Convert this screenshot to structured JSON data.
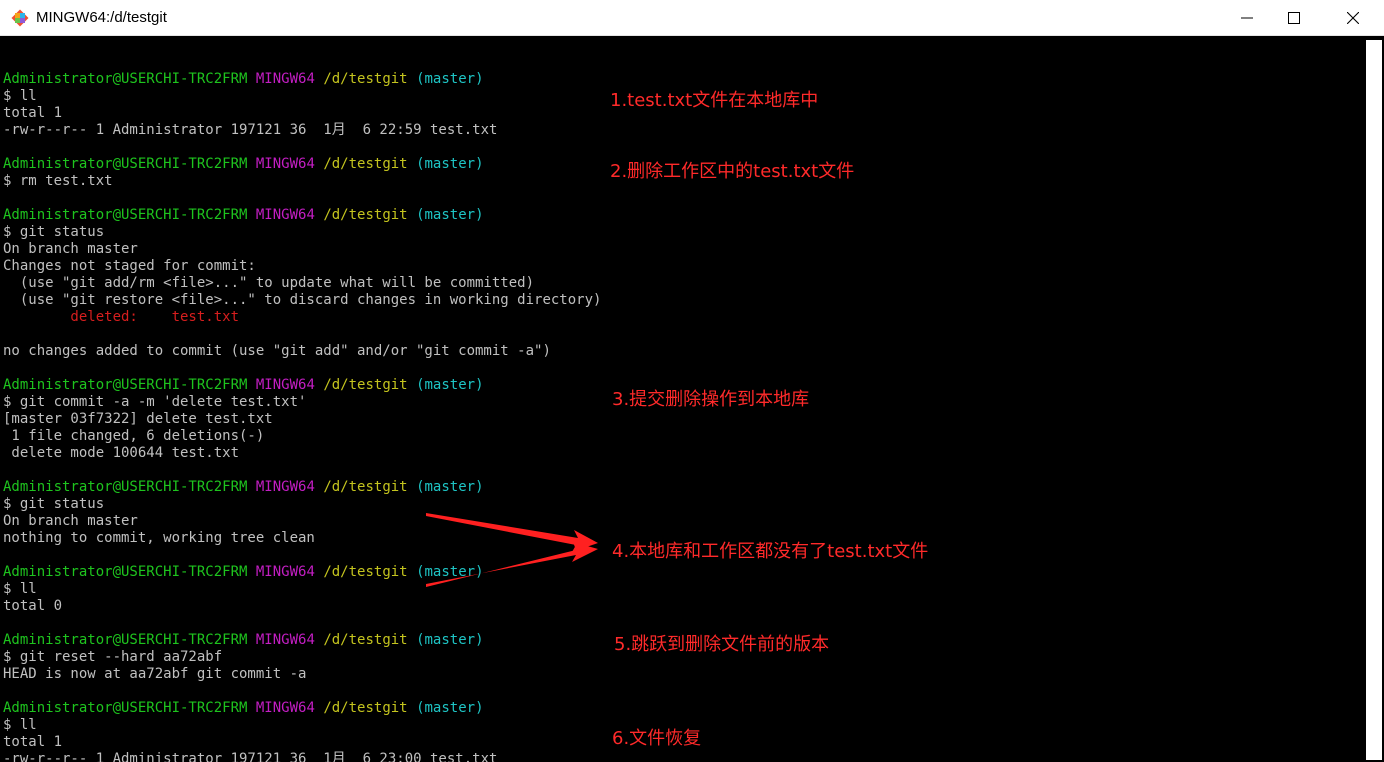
{
  "window": {
    "title": "MINGW64:/d/testgit",
    "app_icon": "git-diamond-icon",
    "controls": [
      "minimize-icon",
      "maximize-icon",
      "close-icon"
    ]
  },
  "prompt": {
    "user": "Administrator@USERCHI-TRC2FRM",
    "env": "MINGW64",
    "path": "/d/testgit",
    "branch": "(master)"
  },
  "terminal_lines": [
    {
      "type": "blank"
    },
    {
      "type": "prompt"
    },
    {
      "type": "text",
      "text": "$ ll"
    },
    {
      "type": "text",
      "text": "total 1"
    },
    {
      "type": "text",
      "text": "-rw-r--r-- 1 Administrator 197121 36  1月  6 22:59 test.txt"
    },
    {
      "type": "blank"
    },
    {
      "type": "prompt"
    },
    {
      "type": "text",
      "text": "$ rm test.txt"
    },
    {
      "type": "blank"
    },
    {
      "type": "prompt"
    },
    {
      "type": "text",
      "text": "$ git status"
    },
    {
      "type": "text",
      "text": "On branch master"
    },
    {
      "type": "text",
      "text": "Changes not staged for commit:"
    },
    {
      "type": "text",
      "text": "  (use \"git add/rm <file>...\" to update what will be committed)"
    },
    {
      "type": "text",
      "text": "  (use \"git restore <file>...\" to discard changes in working directory)"
    },
    {
      "type": "red",
      "text": "        deleted:    test.txt"
    },
    {
      "type": "blank"
    },
    {
      "type": "text",
      "text": "no changes added to commit (use \"git add\" and/or \"git commit -a\")"
    },
    {
      "type": "blank"
    },
    {
      "type": "prompt"
    },
    {
      "type": "text",
      "text": "$ git commit -a -m 'delete test.txt'"
    },
    {
      "type": "text",
      "text": "[master 03f7322] delete test.txt"
    },
    {
      "type": "text",
      "text": " 1 file changed, 6 deletions(-)"
    },
    {
      "type": "text",
      "text": " delete mode 100644 test.txt"
    },
    {
      "type": "blank"
    },
    {
      "type": "prompt"
    },
    {
      "type": "text",
      "text": "$ git status"
    },
    {
      "type": "text",
      "text": "On branch master"
    },
    {
      "type": "text",
      "text": "nothing to commit, working tree clean"
    },
    {
      "type": "blank"
    },
    {
      "type": "prompt"
    },
    {
      "type": "text",
      "text": "$ ll"
    },
    {
      "type": "text",
      "text": "total 0"
    },
    {
      "type": "blank"
    },
    {
      "type": "prompt"
    },
    {
      "type": "text",
      "text": "$ git reset --hard aa72abf"
    },
    {
      "type": "text",
      "text": "HEAD is now at aa72abf git commit -a"
    },
    {
      "type": "blank"
    },
    {
      "type": "prompt"
    },
    {
      "type": "text",
      "text": "$ ll"
    },
    {
      "type": "text",
      "text": "total 1"
    },
    {
      "type": "text",
      "text": "-rw-r--r-- 1 Administrator 197121 36  1月  6 23:00 test.txt"
    }
  ],
  "annotations": [
    {
      "text": "1.test.txt文件在本地库中"
    },
    {
      "text": "2.删除工作区中的test.txt文件"
    },
    {
      "text": "3.提交删除操作到本地库"
    },
    {
      "text": "4.本地库和工作区都没有了test.txt文件"
    },
    {
      "text": "5.跳跃到删除文件前的版本"
    },
    {
      "text": "6.文件恢复"
    }
  ],
  "colors": {
    "background": "#000000",
    "text": "#c0c0c0",
    "user": "#1ec41e",
    "env": "#c31ec3",
    "path": "#c4c41e",
    "branch": "#1ec4c4",
    "deleted": "#d61e1e",
    "annotation": "#ff2a2a"
  }
}
